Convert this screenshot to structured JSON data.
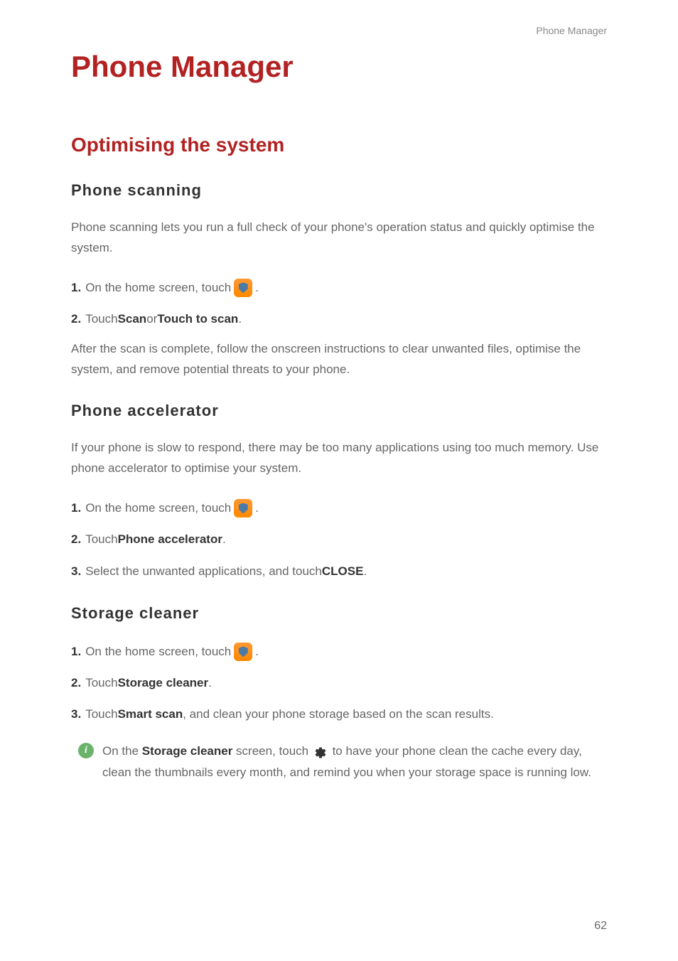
{
  "header": {
    "breadcrumb": "Phone Manager"
  },
  "main": {
    "title": "Phone Manager",
    "section_title": "Optimising the system"
  },
  "sections": {
    "phone_scanning": {
      "title": "Phone scanning",
      "intro": "Phone scanning lets you run a full check of your phone's operation status and quickly optimise the system.",
      "step1_num": "1.",
      "step1_text": "On the home screen, touch ",
      "step1_period": ".",
      "step2_num": "2.",
      "step2_pre": "Touch ",
      "step2_bold1": "Scan",
      "step2_mid": " or ",
      "step2_bold2": "Touch to scan",
      "step2_end": ".",
      "outro": "After the scan is complete, follow the onscreen instructions to clear unwanted files, optimise the system, and remove potential threats to your phone."
    },
    "phone_accelerator": {
      "title": "Phone accelerator",
      "intro": "If your phone is slow to respond, there may be too many applications using too much memory. Use phone accelerator to optimise your system.",
      "step1_num": "1.",
      "step1_text": "On the home screen, touch ",
      "step1_period": ".",
      "step2_num": "2.",
      "step2_pre": "Touch ",
      "step2_bold": "Phone accelerator",
      "step2_end": ".",
      "step3_num": "3.",
      "step3_pre": "Select the unwanted applications, and touch ",
      "step3_bold": "CLOSE",
      "step3_end": "."
    },
    "storage_cleaner": {
      "title": "Storage cleaner",
      "step1_num": "1.",
      "step1_text": "On the home screen, touch ",
      "step1_period": ".",
      "step2_num": "2.",
      "step2_pre": "Touch ",
      "step2_bold": "Storage cleaner",
      "step2_end": ".",
      "step3_num": "3.",
      "step3_pre": "Touch ",
      "step3_bold": "Smart scan",
      "step3_end": ", and clean your phone storage based on the scan results.",
      "tip_pre": "On the ",
      "tip_bold": "Storage cleaner",
      "tip_mid": " screen, touch ",
      "tip_end": " to have your phone clean the cache every day, clean the thumbnails every month, and remind you when your storage space is running low."
    }
  },
  "footer": {
    "page_number": "62"
  },
  "icons": {
    "info_glyph": "i"
  }
}
